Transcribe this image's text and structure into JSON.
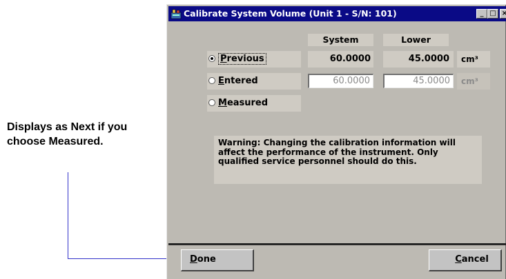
{
  "annotation": {
    "text": "Displays as Next if you choose Measured."
  },
  "window": {
    "title": "Calibrate System Volume (Unit 1 - S/N: 101)",
    "min_glyph": "_",
    "max_glyph": "□",
    "close_glyph": "×"
  },
  "columns": {
    "system": "System",
    "lower": "Lower"
  },
  "options": {
    "previous": {
      "accel": "P",
      "rest": "revious",
      "selected": true
    },
    "entered": {
      "accel": "E",
      "rest": "ntered",
      "selected": false
    },
    "measured": {
      "accel": "M",
      "rest": "easured",
      "selected": false
    }
  },
  "previous_values": {
    "system": "60.0000",
    "lower": "45.0000",
    "unit": "cm³"
  },
  "entered_values": {
    "system": "60.0000",
    "lower": "45.0000",
    "unit": "cm³"
  },
  "warning": "Warning:  Changing the calibration information will affect the performance of the instrument. Only qualified service personnel should do this.",
  "buttons": {
    "done": {
      "accel": "D",
      "rest": "one"
    },
    "cancel": {
      "accel": "C",
      "rest": "ancel"
    }
  },
  "colors": {
    "titlebar": "#0a0a86",
    "dialog_bg": "#bdbab3",
    "callout_line": "#2f2fc8"
  }
}
